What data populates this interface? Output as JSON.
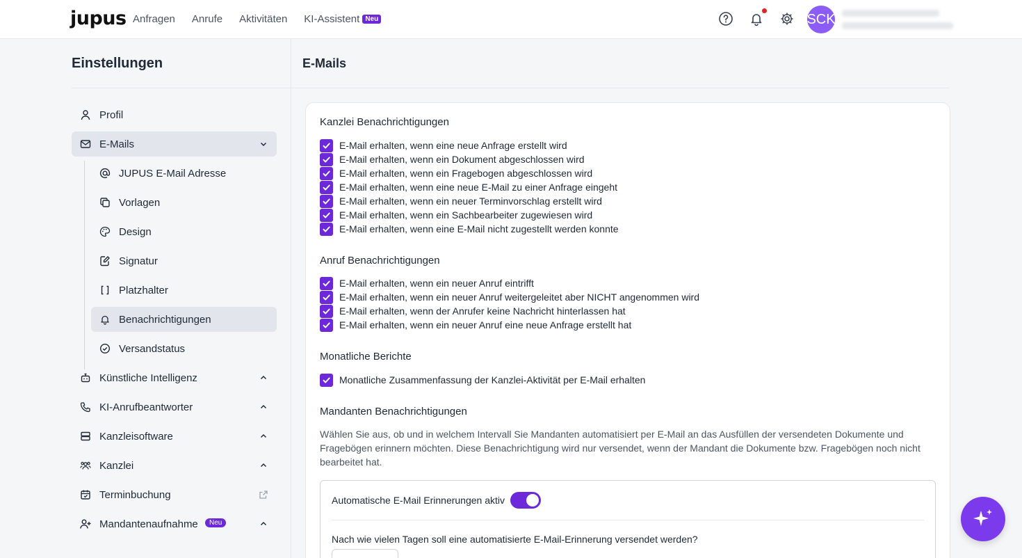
{
  "topnav": {
    "logo": "jupus",
    "links": [
      "Anfragen",
      "Anrufe",
      "Aktivitäten",
      "KI-Assistent"
    ],
    "new_badge": "Neu",
    "avatar_initials": "SCK"
  },
  "sidebar": {
    "title": "Einstellungen",
    "items": [
      {
        "label": "Profil",
        "icon": "user-icon"
      },
      {
        "label": "E-Mails",
        "icon": "mail-icon",
        "expanded": true
      },
      {
        "label": "Künstliche Intelligenz",
        "icon": "robot-icon"
      },
      {
        "label": "KI-Anrufbeantworter",
        "icon": "phone-icon"
      },
      {
        "label": "Kanzleisoftware",
        "icon": "server-icon"
      },
      {
        "label": "Kanzlei",
        "icon": "users-icon"
      },
      {
        "label": "Terminbuchung",
        "icon": "calendar-icon"
      },
      {
        "label": "Mandantenaufnahme",
        "icon": "user-plus-icon",
        "badge": "Neu"
      }
    ],
    "email_subitems": [
      {
        "label": "JUPUS E-Mail Adresse",
        "icon": "at-icon"
      },
      {
        "label": "Vorlagen",
        "icon": "copy-icon"
      },
      {
        "label": "Design",
        "icon": "palette-icon"
      },
      {
        "label": "Signatur",
        "icon": "signature-icon"
      },
      {
        "label": "Platzhalter",
        "icon": "brackets-icon"
      },
      {
        "label": "Benachrichtigungen",
        "icon": "bell-icon",
        "active": true
      },
      {
        "label": "Versandstatus",
        "icon": "check-circle-icon"
      }
    ]
  },
  "main": {
    "title": "E-Mails",
    "kanzlei": {
      "title": "Kanzlei Benachrichtigungen",
      "options": [
        "E-Mail erhalten, wenn eine neue Anfrage erstellt wird",
        "E-Mail erhalten, wenn ein Dokument abgeschlossen wird",
        "E-Mail erhalten, wenn ein Fragebogen abgeschlossen wird",
        "E-Mail erhalten, wenn eine neue E-Mail zu einer Anfrage eingeht",
        "E-Mail erhalten, wenn ein neuer Terminvorschlag erstellt wird",
        "E-Mail erhalten, wenn ein Sachbearbeiter zugewiesen wird",
        "E-Mail erhalten, wenn eine E-Mail nicht zugestellt werden konnte"
      ]
    },
    "anruf": {
      "title": "Anruf Benachrichtigungen",
      "options": [
        "E-Mail erhalten, wenn ein neuer Anruf eintrifft",
        "E-Mail erhalten, wenn ein neuer Anruf weitergeleitet aber NICHT angenommen wird",
        "E-Mail erhalten, wenn der Anrufer keine Nachricht hinterlassen hat",
        "E-Mail erhalten, wenn ein neuer Anruf eine neue Anfrage erstellt hat"
      ]
    },
    "monatlich": {
      "title": "Monatliche Berichte",
      "options": [
        "Monatliche Zusammenfassung der Kanzlei-Aktivität per E-Mail erhalten"
      ]
    },
    "mandanten": {
      "title": "Mandanten Benachrichtigungen",
      "description": "Wählen Sie aus, ob und in welchem Intervall Sie Mandanten automatisiert per E-Mail an das Ausfüllen der versendeten Dokumente und Fragebögen erinnern möchten. Diese Benachrichtigung wird nur versendet, wenn der Mandant die Dokumente bzw. Fragebögen noch nicht bearbeitet hat.",
      "toggle_label": "Automatische E-Mail Erinnerungen aktiv",
      "toggle_on": true,
      "days_question": "Nach wie vielen Tagen soll eine automatisierte E-Mail-Erinnerung versendet werden?"
    }
  },
  "colors": {
    "accent": "#6d28d9",
    "fab": "#7c3aed",
    "avatar": "#8b5cf6"
  }
}
